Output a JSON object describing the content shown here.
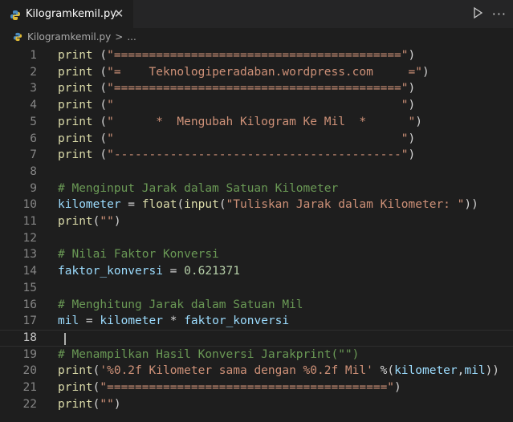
{
  "tab": {
    "label": "Kilogramkemil.py",
    "close": "✕"
  },
  "breadcrumb": {
    "file": "Kilogramkemil.py",
    "separator": ">",
    "trail": "..."
  },
  "actions": {
    "more": "···"
  },
  "editor": {
    "active_line": 18,
    "lines": [
      {
        "n": "1",
        "tokens": [
          [
            "fn",
            "print"
          ],
          [
            "op",
            " ("
          ],
          [
            "str",
            "\"=========================================\""
          ],
          [
            "op",
            ")"
          ]
        ]
      },
      {
        "n": "2",
        "tokens": [
          [
            "fn",
            "print"
          ],
          [
            "op",
            " ("
          ],
          [
            "str",
            "\"=    Teknologiperadaban.wordpress.com     =\""
          ],
          [
            "op",
            ")"
          ]
        ]
      },
      {
        "n": "3",
        "tokens": [
          [
            "fn",
            "print"
          ],
          [
            "op",
            " ("
          ],
          [
            "str",
            "\"=========================================\""
          ],
          [
            "op",
            ")"
          ]
        ]
      },
      {
        "n": "4",
        "tokens": [
          [
            "fn",
            "print"
          ],
          [
            "op",
            " ("
          ],
          [
            "str",
            "\"                                         \""
          ],
          [
            "op",
            ")"
          ]
        ]
      },
      {
        "n": "5",
        "tokens": [
          [
            "fn",
            "print"
          ],
          [
            "op",
            " ("
          ],
          [
            "str",
            "\"      *  Mengubah Kilogram Ke Mil  *      \""
          ],
          [
            "op",
            ")"
          ]
        ]
      },
      {
        "n": "6",
        "tokens": [
          [
            "fn",
            "print"
          ],
          [
            "op",
            " ("
          ],
          [
            "str",
            "\"                                         \""
          ],
          [
            "op",
            ")"
          ]
        ]
      },
      {
        "n": "7",
        "tokens": [
          [
            "fn",
            "print"
          ],
          [
            "op",
            " ("
          ],
          [
            "str",
            "\"-----------------------------------------\""
          ],
          [
            "op",
            ")"
          ]
        ]
      },
      {
        "n": "8",
        "tokens": []
      },
      {
        "n": "9",
        "tokens": [
          [
            "cmt",
            "# Menginput Jarak dalam Satuan Kilometer"
          ]
        ]
      },
      {
        "n": "10",
        "tokens": [
          [
            "var",
            "kilometer"
          ],
          [
            "op",
            " = "
          ],
          [
            "fn",
            "float"
          ],
          [
            "op",
            "("
          ],
          [
            "fn",
            "input"
          ],
          [
            "op",
            "("
          ],
          [
            "str",
            "\"Tuliskan Jarak dalam Kilometer: \""
          ],
          [
            "op",
            "))"
          ]
        ]
      },
      {
        "n": "11",
        "tokens": [
          [
            "fn",
            "print"
          ],
          [
            "op",
            "("
          ],
          [
            "str",
            "\"\""
          ],
          [
            "op",
            ")"
          ]
        ]
      },
      {
        "n": "12",
        "tokens": []
      },
      {
        "n": "13",
        "tokens": [
          [
            "cmt",
            "# Nilai Faktor Konversi"
          ]
        ]
      },
      {
        "n": "14",
        "tokens": [
          [
            "var",
            "faktor_konversi"
          ],
          [
            "op",
            " = "
          ],
          [
            "num",
            "0.621371"
          ]
        ]
      },
      {
        "n": "15",
        "tokens": []
      },
      {
        "n": "16",
        "tokens": [
          [
            "cmt",
            "# Menghitung Jarak dalam Satuan Mil"
          ]
        ]
      },
      {
        "n": "17",
        "tokens": [
          [
            "var",
            "mil"
          ],
          [
            "op",
            " = "
          ],
          [
            "var",
            "kilometer"
          ],
          [
            "op",
            " * "
          ],
          [
            "var",
            "faktor_konversi"
          ]
        ]
      },
      {
        "n": "18",
        "tokens": []
      },
      {
        "n": "19",
        "tokens": [
          [
            "cmt",
            "# Menampilkan Hasil Konversi Jarakprint(\"\")"
          ]
        ]
      },
      {
        "n": "20",
        "tokens": [
          [
            "fn",
            "print"
          ],
          [
            "op",
            "("
          ],
          [
            "str",
            "'%0.2f Kilometer sama dengan %0.2f Mil'"
          ],
          [
            "op",
            " %("
          ],
          [
            "var",
            "kilometer"
          ],
          [
            "op",
            ","
          ],
          [
            "var",
            "mil"
          ],
          [
            "op",
            "))"
          ]
        ]
      },
      {
        "n": "21",
        "tokens": [
          [
            "fn",
            "print"
          ],
          [
            "op",
            "("
          ],
          [
            "str",
            "\"========================================\""
          ],
          [
            "op",
            ")"
          ]
        ]
      },
      {
        "n": "22",
        "tokens": [
          [
            "fn",
            "print"
          ],
          [
            "op",
            "("
          ],
          [
            "str",
            "\"\""
          ],
          [
            "op",
            ")"
          ]
        ]
      }
    ]
  }
}
